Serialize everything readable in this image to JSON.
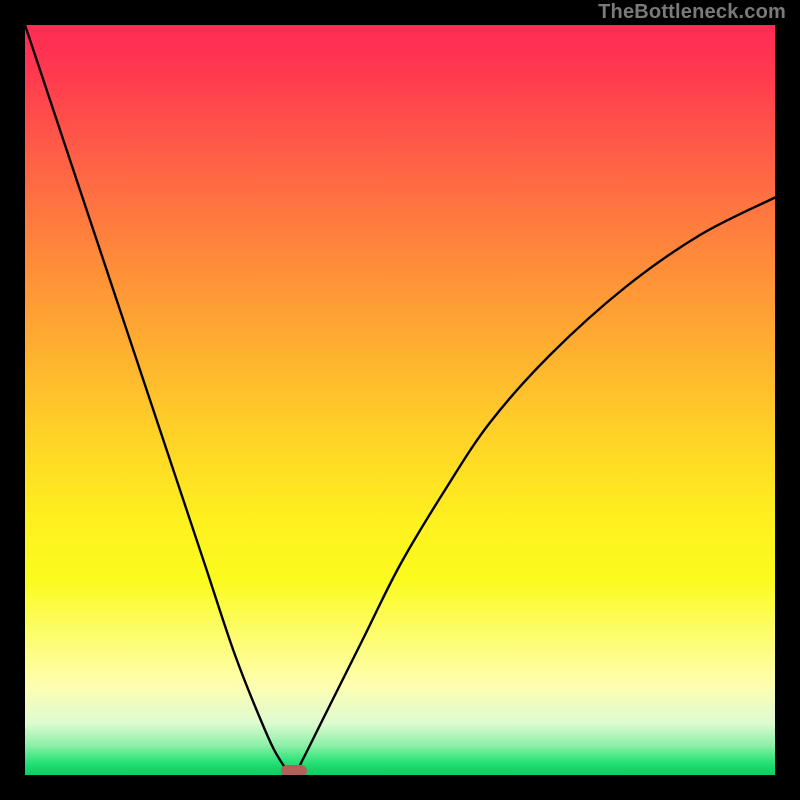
{
  "watermark": "TheBottleneck.com",
  "chart_data": {
    "type": "line",
    "title": "",
    "xlabel": "",
    "ylabel": "",
    "xlim": [
      0,
      100
    ],
    "ylim": [
      0,
      100
    ],
    "grid": false,
    "legend": false,
    "background": {
      "style": "vertical-gradient",
      "stops": [
        {
          "pos": 0,
          "color": "#ff2a55"
        },
        {
          "pos": 50,
          "color": "#ffd626"
        },
        {
          "pos": 88,
          "color": "#fefeb0"
        },
        {
          "pos": 100,
          "color": "#0bd061"
        }
      ]
    },
    "series": [
      {
        "name": "bottleneck-curve",
        "color": "#000000",
        "x": [
          0,
          4,
          8,
          12,
          16,
          20,
          24,
          28,
          32,
          34,
          35.8,
          37,
          40,
          45,
          50,
          56,
          62,
          70,
          80,
          90,
          100
        ],
        "values": [
          100,
          88,
          76,
          64,
          52,
          40,
          28,
          16,
          6,
          2,
          0,
          2,
          8,
          18,
          28,
          38,
          47,
          56,
          65,
          72,
          77
        ]
      }
    ],
    "marker": {
      "name": "optimal-point",
      "x": 35.8,
      "y": 0,
      "color": "#b2615a",
      "shape": "pill"
    }
  }
}
